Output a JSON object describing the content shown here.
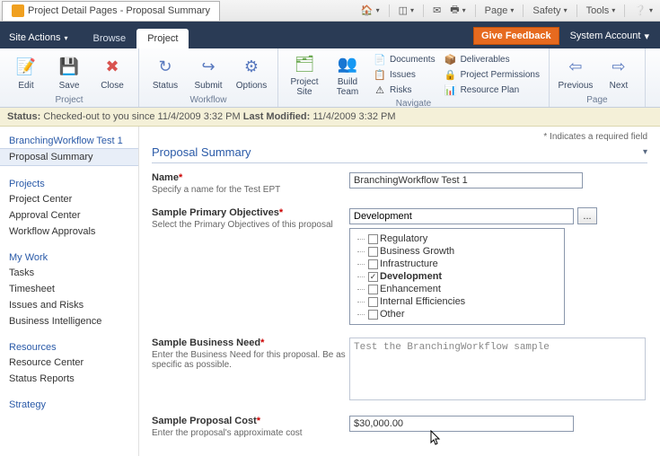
{
  "chrome": {
    "tab_title": "Project Detail Pages - Proposal Summary",
    "tools": {
      "page": "Page",
      "safety": "Safety",
      "tools": "Tools"
    }
  },
  "header": {
    "site_actions": "Site Actions",
    "tabs": {
      "browse": "Browse",
      "project": "Project"
    },
    "feedback": "Give Feedback",
    "system_account": "System Account"
  },
  "ribbon": {
    "groups": {
      "project": {
        "label": "Project",
        "edit": "Edit",
        "save": "Save",
        "close": "Close"
      },
      "workflow": {
        "label": "Workflow",
        "status": "Status",
        "submit": "Submit",
        "options": "Options"
      },
      "navigate": {
        "label": "Navigate",
        "project_site": "Project\nSite",
        "build_team": "Build\nTeam",
        "documents": "Documents",
        "issues": "Issues",
        "risks": "Risks",
        "deliverables": "Deliverables",
        "project_permissions": "Project Permissions",
        "resource_plan": "Resource Plan"
      },
      "page": {
        "label": "Page",
        "previous": "Previous",
        "next": "Next"
      }
    }
  },
  "status": {
    "prefix": "Status: ",
    "checked_out": "Checked-out to you since 11/4/2009 3:32 PM ",
    "last_mod_label": "Last Modified:",
    "last_mod_value": " 11/4/2009 3:32 PM"
  },
  "leftnav": {
    "current_title": "BranchingWorkflow Test 1",
    "current_page": "Proposal Summary",
    "projects": {
      "h": "Projects",
      "items": [
        "Project Center",
        "Approval Center",
        "Workflow Approvals"
      ]
    },
    "mywork": {
      "h": "My Work",
      "items": [
        "Tasks",
        "Timesheet",
        "Issues and Risks",
        "Business Intelligence"
      ]
    },
    "resources": {
      "h": "Resources",
      "items": [
        "Resource Center",
        "Status Reports"
      ]
    },
    "strategy": {
      "h": "Strategy"
    }
  },
  "content": {
    "required_note": "* Indicates a required field",
    "section_title": "Proposal Summary",
    "fields": {
      "name": {
        "label": "Name",
        "req": "*",
        "desc": "Specify a name for the Test EPT",
        "value": "BranchingWorkflow Test 1"
      },
      "objectives": {
        "label": "Sample Primary Objectives",
        "req": "*",
        "desc": "Select the Primary Objectives of this proposal",
        "selected": "Development",
        "options": [
          "Regulatory",
          "Business Growth",
          "Infrastructure",
          "Development",
          "Enhancement",
          "Internal Efficiencies",
          "Other"
        ],
        "ellipsis": "..."
      },
      "need": {
        "label": "Sample Business Need",
        "req": "*",
        "desc": "Enter the Business Need for this proposal. Be as specific as possible.",
        "value": "Test the BranchingWorkflow sample"
      },
      "cost": {
        "label": "Sample Proposal Cost",
        "req": "*",
        "desc": "Enter the proposal's approximate cost",
        "value": "$30,000.00"
      }
    }
  }
}
